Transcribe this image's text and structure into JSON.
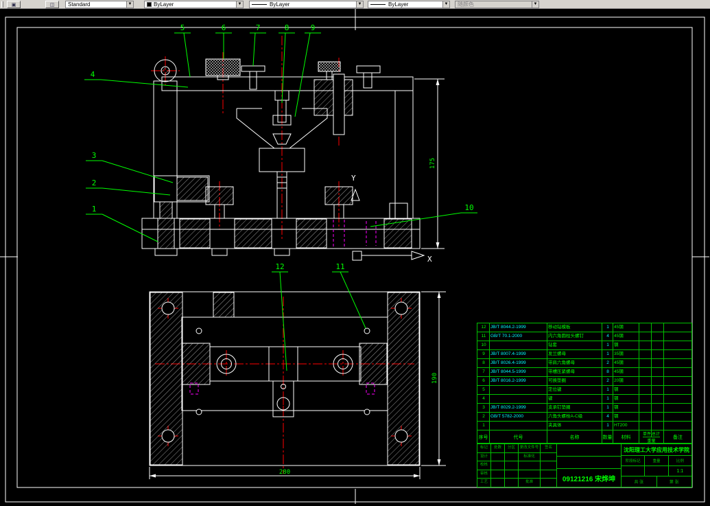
{
  "toolbar": {
    "style": {
      "label": "Standard"
    },
    "color": {
      "label": "ByLayer"
    },
    "linetype": {
      "label": "ByLayer"
    },
    "lineweight": {
      "label": "ByLayer"
    },
    "plot_style": {
      "label": "随颜色"
    }
  },
  "colors": {
    "line": "#ffffff",
    "accent_green": "#00ff00",
    "centerline_red": "#ff0000",
    "hidden_magenta": "#ff00ff",
    "cyan": "#00ffff",
    "toolbar_gray": "#d6d3ce"
  },
  "drawing": {
    "balloons": [
      "1",
      "2",
      "3",
      "4",
      "5",
      "6",
      "7",
      "8",
      "9",
      "10",
      "11",
      "12"
    ],
    "dimensions": {
      "front_height": "175",
      "plate_height": "190",
      "plate_width": "280"
    },
    "axes": {
      "x": "X",
      "y": "Y"
    }
  },
  "bom": {
    "headers": {
      "num": "序号",
      "code": "代号",
      "name": "名称",
      "qty": "数量",
      "material": "材料",
      "unit": "单件",
      "total": "总计",
      "weight": "重量",
      "remark": "备注"
    },
    "rows": [
      {
        "num": "12",
        "code": "JB/T 8044.2-1999",
        "name": "移动钻模板",
        "qty": "1",
        "material": "45钢",
        "unit": "",
        "total": "",
        "remark": ""
      },
      {
        "num": "11",
        "code": "GB/T 70.1-2000",
        "name": "内六角圆柱头螺钉",
        "qty": "4",
        "material": "45钢",
        "unit": "",
        "total": "",
        "remark": ""
      },
      {
        "num": "10",
        "code": "",
        "name": "钻套",
        "qty": "1",
        "material": "钢",
        "unit": "",
        "total": "",
        "remark": ""
      },
      {
        "num": "9",
        "code": "JB/T 8007.4-1999",
        "name": "发兰螺母",
        "qty": "1",
        "material": "35钢",
        "unit": "",
        "total": "",
        "remark": ""
      },
      {
        "num": "8",
        "code": "JB/T 8026.4-1999",
        "name": "带肩六角螺母",
        "qty": "2",
        "material": "45钢",
        "unit": "",
        "total": "",
        "remark": ""
      },
      {
        "num": "7",
        "code": "JB/T 8044.5-1999",
        "name": "带槽压紧螺母",
        "qty": "8",
        "material": "45钢",
        "unit": "",
        "total": "",
        "remark": ""
      },
      {
        "num": "6",
        "code": "JB/T 8016.2-1999",
        "name": "可换垫圈",
        "qty": "2",
        "material": "20钢",
        "unit": "",
        "total": "",
        "remark": ""
      },
      {
        "num": "5",
        "code": "",
        "name": "定位键",
        "qty": "1",
        "material": "钢",
        "unit": "",
        "total": "",
        "remark": ""
      },
      {
        "num": "4",
        "code": "",
        "name": "键",
        "qty": "1",
        "material": "钢",
        "unit": "",
        "total": "",
        "remark": ""
      },
      {
        "num": "3",
        "code": "JB/T 8029.2-1999",
        "name": "支承钉垫圈",
        "qty": "1",
        "material": "钢",
        "unit": "",
        "total": "",
        "remark": ""
      },
      {
        "num": "2",
        "code": "GB/T 5782-2000",
        "name": "六角头螺栓A-C级",
        "qty": "4",
        "material": "钢",
        "unit": "",
        "total": "",
        "remark": ""
      },
      {
        "num": "1",
        "code": "",
        "name": "夹具体",
        "qty": "1",
        "material": "HT200",
        "unit": "",
        "total": "",
        "remark": ""
      }
    ]
  },
  "title_block": {
    "school": "沈阳理工大学应用技术学院",
    "drawing_title": "09121216 宋烨坤",
    "scale_value": "1:1",
    "left_grid": [
      [
        "标记",
        "处数",
        "分区",
        "更改文件号",
        "签名"
      ],
      [
        "设计",
        "",
        "",
        "标准化",
        ""
      ],
      [
        "校核",
        "",
        "",
        "",
        ""
      ],
      [
        "审核",
        "",
        "",
        "",
        ""
      ],
      [
        "工艺",
        "",
        "",
        "批准",
        ""
      ]
    ],
    "labels": {
      "stage": "阶段标记",
      "weight": "重量",
      "scale": "比例",
      "sheets": "共 张",
      "sheet_no": "第 张"
    }
  }
}
